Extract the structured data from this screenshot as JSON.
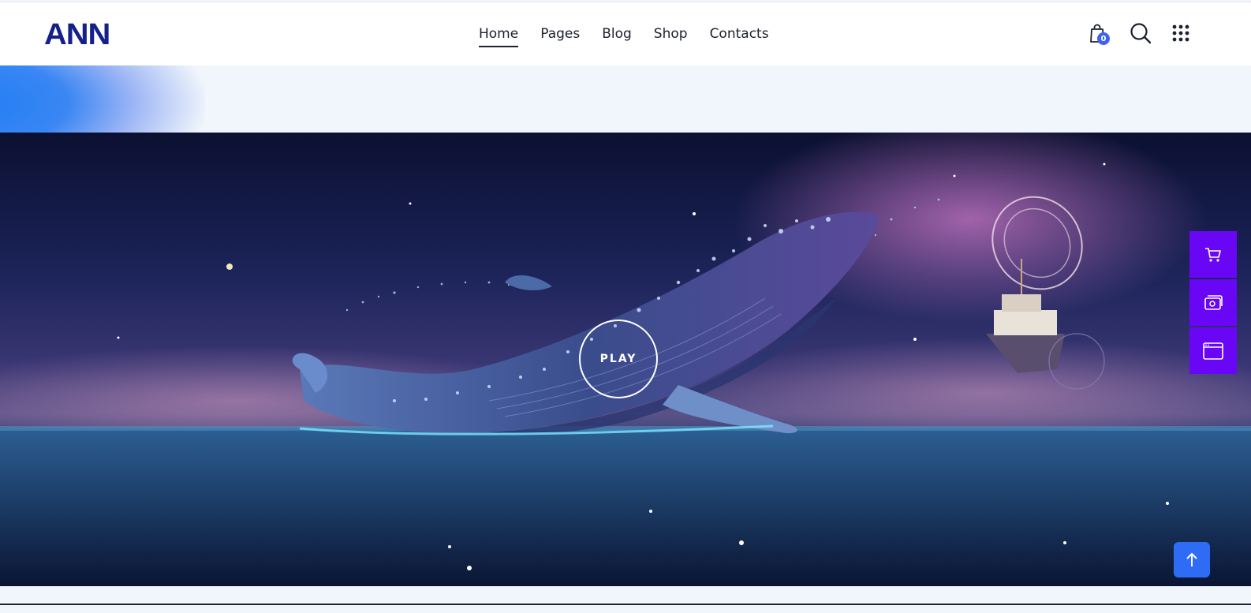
{
  "header": {
    "logo_text": "ANN",
    "nav": [
      {
        "label": "Home",
        "active": true
      },
      {
        "label": "Pages",
        "active": false
      },
      {
        "label": "Blog",
        "active": false
      },
      {
        "label": "Shop",
        "active": false
      },
      {
        "label": "Contacts",
        "active": false
      }
    ],
    "cart_count": "0",
    "icons": [
      "shopping-bag-icon",
      "search-icon",
      "grid-menu-icon"
    ]
  },
  "hero": {
    "image_subject": "whale leaping from ocean at night with ship",
    "play_label": "PLAY"
  },
  "side_buttons": [
    "cart-icon",
    "gallery-icon",
    "browser-window-icon"
  ],
  "scroll_top_icon": "arrow-up-icon",
  "colors": {
    "brand": "#16208a",
    "accent_purple": "#6a06f6",
    "accent_blue": "#2f6cf5",
    "badge": "#3f63f0"
  }
}
